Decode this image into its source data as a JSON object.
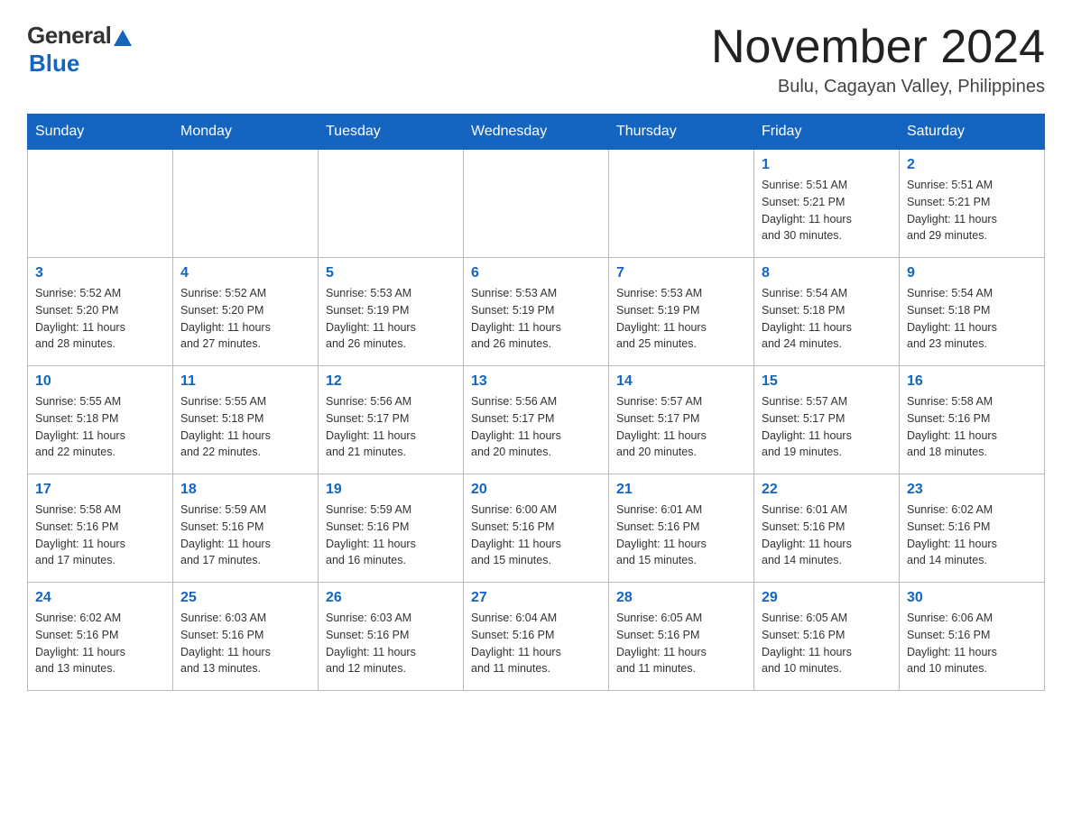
{
  "header": {
    "logo_general": "General",
    "logo_blue": "Blue",
    "month_title": "November 2024",
    "location": "Bulu, Cagayan Valley, Philippines"
  },
  "weekdays": [
    "Sunday",
    "Monday",
    "Tuesday",
    "Wednesday",
    "Thursday",
    "Friday",
    "Saturday"
  ],
  "weeks": [
    [
      {
        "day": "",
        "info": ""
      },
      {
        "day": "",
        "info": ""
      },
      {
        "day": "",
        "info": ""
      },
      {
        "day": "",
        "info": ""
      },
      {
        "day": "",
        "info": ""
      },
      {
        "day": "1",
        "info": "Sunrise: 5:51 AM\nSunset: 5:21 PM\nDaylight: 11 hours\nand 30 minutes."
      },
      {
        "day": "2",
        "info": "Sunrise: 5:51 AM\nSunset: 5:21 PM\nDaylight: 11 hours\nand 29 minutes."
      }
    ],
    [
      {
        "day": "3",
        "info": "Sunrise: 5:52 AM\nSunset: 5:20 PM\nDaylight: 11 hours\nand 28 minutes."
      },
      {
        "day": "4",
        "info": "Sunrise: 5:52 AM\nSunset: 5:20 PM\nDaylight: 11 hours\nand 27 minutes."
      },
      {
        "day": "5",
        "info": "Sunrise: 5:53 AM\nSunset: 5:19 PM\nDaylight: 11 hours\nand 26 minutes."
      },
      {
        "day": "6",
        "info": "Sunrise: 5:53 AM\nSunset: 5:19 PM\nDaylight: 11 hours\nand 26 minutes."
      },
      {
        "day": "7",
        "info": "Sunrise: 5:53 AM\nSunset: 5:19 PM\nDaylight: 11 hours\nand 25 minutes."
      },
      {
        "day": "8",
        "info": "Sunrise: 5:54 AM\nSunset: 5:18 PM\nDaylight: 11 hours\nand 24 minutes."
      },
      {
        "day": "9",
        "info": "Sunrise: 5:54 AM\nSunset: 5:18 PM\nDaylight: 11 hours\nand 23 minutes."
      }
    ],
    [
      {
        "day": "10",
        "info": "Sunrise: 5:55 AM\nSunset: 5:18 PM\nDaylight: 11 hours\nand 22 minutes."
      },
      {
        "day": "11",
        "info": "Sunrise: 5:55 AM\nSunset: 5:18 PM\nDaylight: 11 hours\nand 22 minutes."
      },
      {
        "day": "12",
        "info": "Sunrise: 5:56 AM\nSunset: 5:17 PM\nDaylight: 11 hours\nand 21 minutes."
      },
      {
        "day": "13",
        "info": "Sunrise: 5:56 AM\nSunset: 5:17 PM\nDaylight: 11 hours\nand 20 minutes."
      },
      {
        "day": "14",
        "info": "Sunrise: 5:57 AM\nSunset: 5:17 PM\nDaylight: 11 hours\nand 20 minutes."
      },
      {
        "day": "15",
        "info": "Sunrise: 5:57 AM\nSunset: 5:17 PM\nDaylight: 11 hours\nand 19 minutes."
      },
      {
        "day": "16",
        "info": "Sunrise: 5:58 AM\nSunset: 5:16 PM\nDaylight: 11 hours\nand 18 minutes."
      }
    ],
    [
      {
        "day": "17",
        "info": "Sunrise: 5:58 AM\nSunset: 5:16 PM\nDaylight: 11 hours\nand 17 minutes."
      },
      {
        "day": "18",
        "info": "Sunrise: 5:59 AM\nSunset: 5:16 PM\nDaylight: 11 hours\nand 17 minutes."
      },
      {
        "day": "19",
        "info": "Sunrise: 5:59 AM\nSunset: 5:16 PM\nDaylight: 11 hours\nand 16 minutes."
      },
      {
        "day": "20",
        "info": "Sunrise: 6:00 AM\nSunset: 5:16 PM\nDaylight: 11 hours\nand 15 minutes."
      },
      {
        "day": "21",
        "info": "Sunrise: 6:01 AM\nSunset: 5:16 PM\nDaylight: 11 hours\nand 15 minutes."
      },
      {
        "day": "22",
        "info": "Sunrise: 6:01 AM\nSunset: 5:16 PM\nDaylight: 11 hours\nand 14 minutes."
      },
      {
        "day": "23",
        "info": "Sunrise: 6:02 AM\nSunset: 5:16 PM\nDaylight: 11 hours\nand 14 minutes."
      }
    ],
    [
      {
        "day": "24",
        "info": "Sunrise: 6:02 AM\nSunset: 5:16 PM\nDaylight: 11 hours\nand 13 minutes."
      },
      {
        "day": "25",
        "info": "Sunrise: 6:03 AM\nSunset: 5:16 PM\nDaylight: 11 hours\nand 13 minutes."
      },
      {
        "day": "26",
        "info": "Sunrise: 6:03 AM\nSunset: 5:16 PM\nDaylight: 11 hours\nand 12 minutes."
      },
      {
        "day": "27",
        "info": "Sunrise: 6:04 AM\nSunset: 5:16 PM\nDaylight: 11 hours\nand 11 minutes."
      },
      {
        "day": "28",
        "info": "Sunrise: 6:05 AM\nSunset: 5:16 PM\nDaylight: 11 hours\nand 11 minutes."
      },
      {
        "day": "29",
        "info": "Sunrise: 6:05 AM\nSunset: 5:16 PM\nDaylight: 11 hours\nand 10 minutes."
      },
      {
        "day": "30",
        "info": "Sunrise: 6:06 AM\nSunset: 5:16 PM\nDaylight: 11 hours\nand 10 minutes."
      }
    ]
  ]
}
